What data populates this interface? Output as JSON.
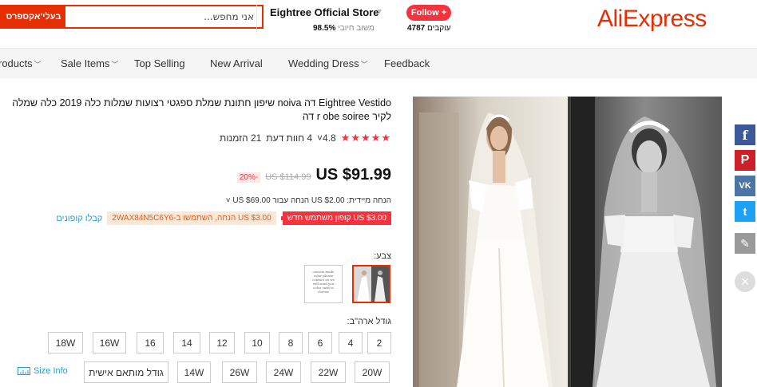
{
  "header": {
    "search_button": "בעלי'אקספרס",
    "search_placeholder": "אני מחפש...",
    "store_name": "Eightree Official Store",
    "store_rating_value": "98.5%",
    "store_rating_label": "משוב חיובי",
    "follow_label": "Follow +",
    "followers_value": "4787",
    "followers_label": "עוקבים",
    "logo": "AliExpress",
    "colors": {
      "accent": "#e62e04",
      "follow": "#f5333f"
    }
  },
  "nav": {
    "items": [
      {
        "label": "roducts",
        "has_dropdown": true
      },
      {
        "label": "Sale Items",
        "has_dropdown": true
      },
      {
        "label": "Top Selling",
        "has_dropdown": false
      },
      {
        "label": "New Arrival",
        "has_dropdown": false
      },
      {
        "label": "Wedding Dress",
        "has_dropdown": true
      },
      {
        "label": "Feedback",
        "has_dropdown": false
      }
    ]
  },
  "product": {
    "title": "Eightree Vestido דה noiva שיפון חתונת שמלת ספגטי רצועות שמלות כלה 2019 כלה שמלה לקיר r obe soiree דה",
    "stars": "★★★★★",
    "rating": "4.8",
    "rating_chevron": "˅",
    "reviews": "4 חוות דעת",
    "orders": "21 הזמנות",
    "price": "US $91.99",
    "old_price": "US $114.99",
    "discount": "-20%",
    "bulk_discount": "הנחה מיידית: US $2.00 הנחה עבור US $69.00 ˅",
    "coupon_new_user": "US $3.00 קופון משתמש חדש",
    "coupon_store": "US $3.00 הנחה, השתמשו ב-2WAX84N5C6Y6",
    "get_coupons": "קבלו קופונים",
    "color_label": "צבע:",
    "swatch_note": "custom made color please contact us we will send you color card to choose",
    "size_label": "גודל ארה\"ב:",
    "sizes_row1": [
      "2",
      "4",
      "6",
      "8",
      "10",
      "12",
      "14",
      "16",
      "16W",
      "18W"
    ],
    "sizes_row2": [
      "20W",
      "22W",
      "24W",
      "26W",
      "14W",
      "גודל מותאם אישית"
    ],
    "size_info": "Size Info"
  },
  "share": {
    "icons": [
      "facebook-icon",
      "pinterest-icon",
      "vk-icon",
      "twitter-icon",
      "edit-icon",
      "close-icon"
    ],
    "colors": [
      "#3b5998",
      "#cb2027",
      "#4c75a3",
      "#1da1f2",
      "#999999",
      "#dddddd"
    ]
  }
}
